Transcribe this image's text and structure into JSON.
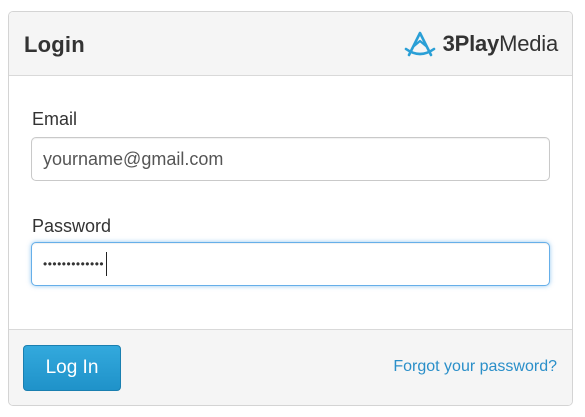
{
  "header": {
    "title": "Login",
    "logo": {
      "icon": "3play-logo-icon",
      "text_bold": "3Play",
      "text_regular": "Media",
      "color": "#2a9fd6"
    }
  },
  "form": {
    "email": {
      "label": "Email",
      "value": "yourname@gmail.com"
    },
    "password": {
      "label": "Password",
      "masked_value": "•••••••••••••",
      "focused": true
    }
  },
  "footer": {
    "login_label": "Log In",
    "forgot_label": "Forgot your password?"
  },
  "colors": {
    "accent": "#2a9fd6",
    "link": "#2a8fc9",
    "focus_ring": "#66afe9"
  }
}
